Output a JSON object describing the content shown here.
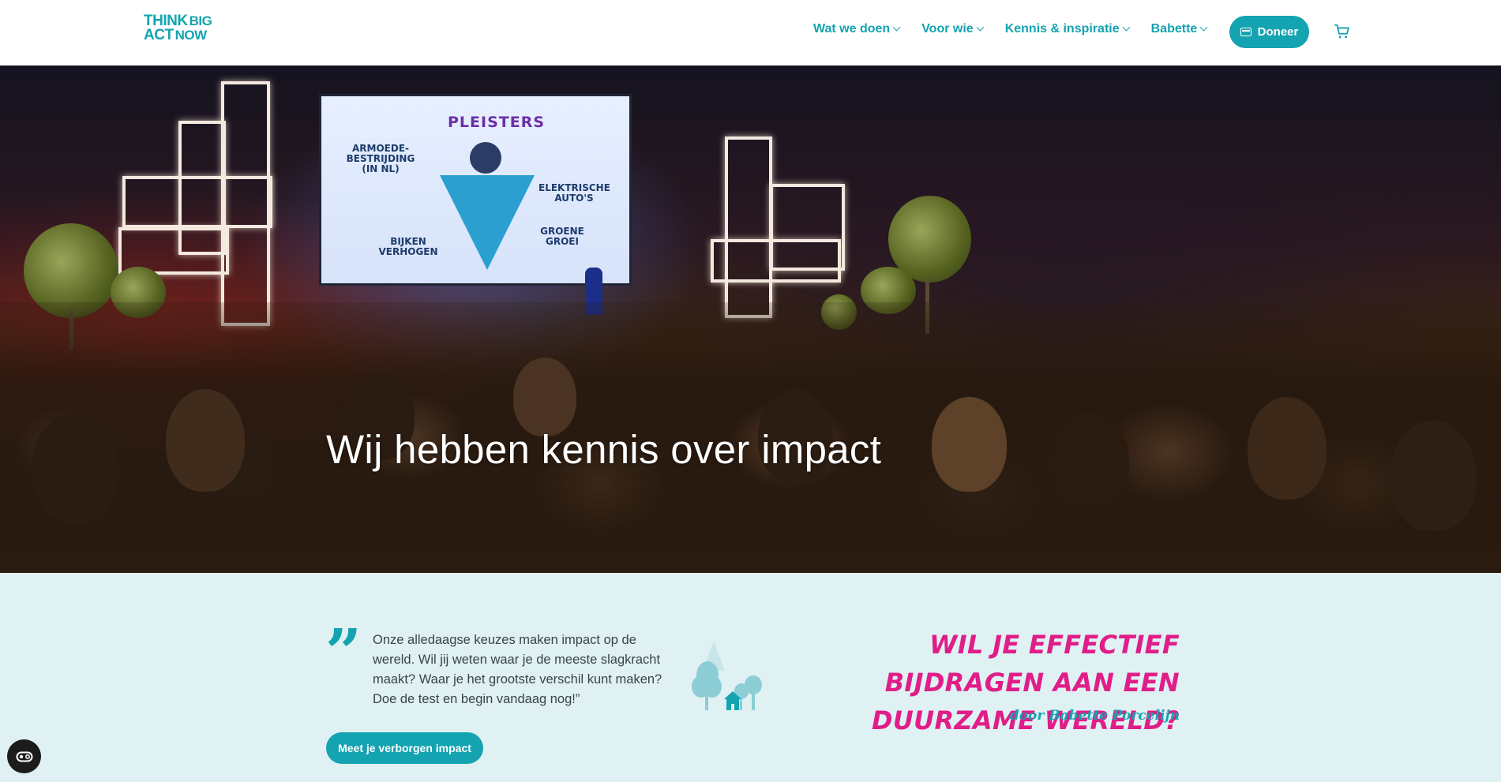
{
  "header": {
    "logo": {
      "line1_a": "THINK",
      "line1_b": "BIG",
      "line2_a": "ACT",
      "line2_b": "NOW"
    },
    "nav": [
      {
        "label": "Wat we doen"
      },
      {
        "label": "Voor wie"
      },
      {
        "label": "Kennis & inspiratie"
      },
      {
        "label": "Babette"
      }
    ],
    "donate_label": "Doneer",
    "cart_icon": "cart-icon",
    "donate_icon": "wallet-icon"
  },
  "hero": {
    "title": "Wij hebben kennis over impact",
    "screen": {
      "heading": "PLEISTERS",
      "labels": [
        "ARMOEDE-BESTRIJDING (IN NL)",
        "ELEKTRISCHE AUTO'S",
        "GROENE GROEI",
        "BIJKEN VERHOGEN"
      ]
    }
  },
  "intro": {
    "quote_mark": "”",
    "quote": "Onze alledaagse keuzes maken impact op de wereld. Wil jij weten waar je de meeste slagkracht maakt? Waar je het grootste verschil kunt maken? Doe de test en begin vandaag nog!”",
    "cta_label": "Meet je verborgen impact",
    "slogan": "Wil je effectief bijdragen aan een duurzame wereld?",
    "byline": "door Babette Porcelijn"
  },
  "colors": {
    "brand_teal": "#14a3b0",
    "accent_pink": "#e01d88",
    "intro_background": "#dff1f3"
  },
  "cookie_icon": "cookie-settings-icon"
}
